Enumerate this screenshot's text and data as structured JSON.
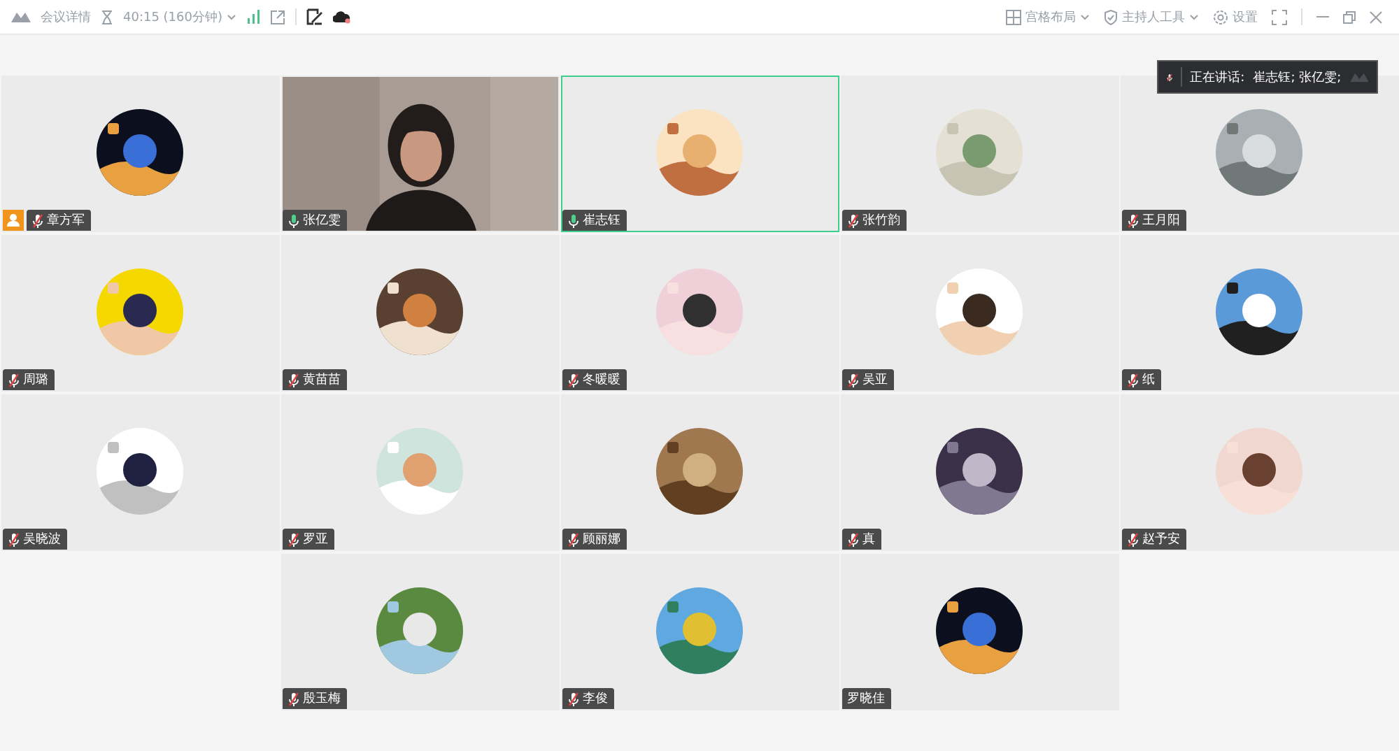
{
  "toolbar": {
    "meeting_info": "会议详情",
    "timer": "40:15 (160分钟)",
    "layout": "宫格布局",
    "host_tools": "主持人工具",
    "settings": "设置"
  },
  "speaking_banner": {
    "label": "正在讲话:",
    "names": "崔志钰; 张亿雯;"
  },
  "participants": [
    {
      "name": "章方军",
      "kind": "avatar",
      "muted": true,
      "speaking": false,
      "host": true,
      "highlighted": false
    },
    {
      "name": "张亿雯",
      "kind": "video",
      "muted": false,
      "speaking": true,
      "host": false,
      "highlighted": false
    },
    {
      "name": "崔志钰",
      "kind": "avatar",
      "muted": false,
      "speaking": true,
      "host": false,
      "highlighted": true
    },
    {
      "name": "张竹韵",
      "kind": "avatar",
      "muted": true,
      "speaking": false,
      "host": false,
      "highlighted": false
    },
    {
      "name": "王月阳",
      "kind": "avatar",
      "muted": true,
      "speaking": false,
      "host": false,
      "highlighted": false
    },
    {
      "name": "周璐",
      "kind": "avatar",
      "muted": true,
      "speaking": false,
      "host": false,
      "highlighted": false
    },
    {
      "name": "黄苗苗",
      "kind": "avatar",
      "muted": true,
      "speaking": false,
      "host": false,
      "highlighted": false
    },
    {
      "name": "冬暖暖",
      "kind": "avatar",
      "muted": true,
      "speaking": false,
      "host": false,
      "highlighted": false
    },
    {
      "name": "吴亚",
      "kind": "avatar",
      "muted": true,
      "speaking": false,
      "host": false,
      "highlighted": false
    },
    {
      "name": "纸",
      "kind": "avatar",
      "muted": true,
      "speaking": false,
      "host": false,
      "highlighted": false
    },
    {
      "name": "吴晓波",
      "kind": "avatar",
      "muted": true,
      "speaking": false,
      "host": false,
      "highlighted": false
    },
    {
      "name": "罗亚",
      "kind": "avatar",
      "muted": true,
      "speaking": false,
      "host": false,
      "highlighted": false
    },
    {
      "name": "顾丽娜",
      "kind": "avatar",
      "muted": true,
      "speaking": false,
      "host": false,
      "highlighted": false
    },
    {
      "name": "真",
      "kind": "avatar",
      "muted": true,
      "speaking": false,
      "host": false,
      "highlighted": false
    },
    {
      "name": "赵予安",
      "kind": "avatar",
      "muted": true,
      "speaking": false,
      "host": false,
      "highlighted": false
    },
    {
      "name": "殷玉梅",
      "kind": "avatar",
      "muted": true,
      "speaking": false,
      "host": false,
      "highlighted": false
    },
    {
      "name": "李俊",
      "kind": "avatar",
      "muted": true,
      "speaking": false,
      "host": false,
      "highlighted": false
    },
    {
      "name": "罗晓佳",
      "kind": "avatar",
      "muted": false,
      "speaking": false,
      "host": false,
      "highlighted": false
    }
  ]
}
